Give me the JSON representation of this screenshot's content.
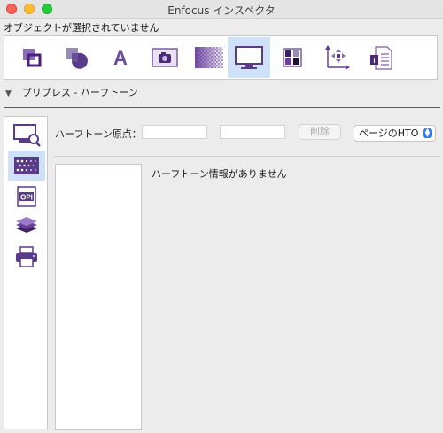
{
  "window": {
    "title": "Enfocus インスペクタ"
  },
  "selection_status": "オブジェクトが選択されていません",
  "toolbar": {
    "tools": [
      {
        "icon": "object-arrange-icon"
      },
      {
        "icon": "fill-stroke-icon"
      },
      {
        "icon": "text-icon"
      },
      {
        "icon": "image-icon"
      },
      {
        "icon": "transparency-icon"
      },
      {
        "icon": "prepress-monitor-icon",
        "selected": true
      },
      {
        "icon": "color-swatch-icon"
      },
      {
        "icon": "position-axes-icon"
      },
      {
        "icon": "document-info-icon"
      }
    ]
  },
  "section": {
    "title": "プリプレス - ハーフトーン"
  },
  "sidebar": {
    "items": [
      {
        "icon": "monitor-magnify-icon"
      },
      {
        "icon": "halftone-icon",
        "selected": true
      },
      {
        "icon": "opi-icon",
        "text": "OPI"
      },
      {
        "icon": "layers-icon"
      },
      {
        "icon": "printer-icon"
      }
    ]
  },
  "halftone": {
    "origin_label": "ハーフトーン原点：",
    "origin_x": "",
    "origin_y": "",
    "delete_label": "削除",
    "source_select": "ページのHTO",
    "no_info_message": "ハーフトーン情報がありません"
  },
  "colors": {
    "accent": "#6a3f9a",
    "selected_bg": "#cfe1f8",
    "select_chevron": "#2f7bf5"
  }
}
